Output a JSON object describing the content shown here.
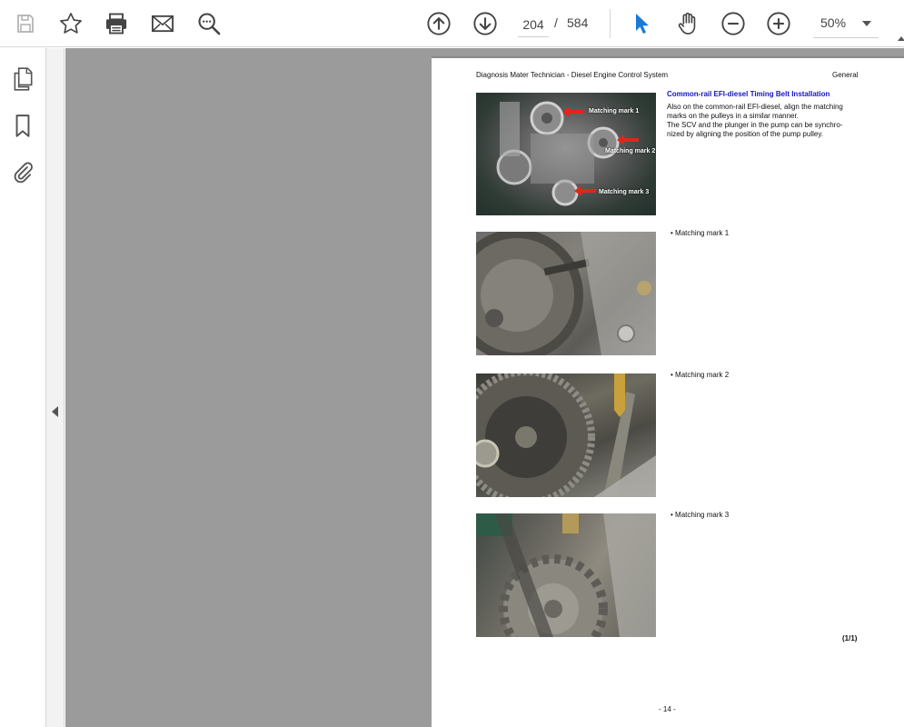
{
  "toolbar": {
    "page_current": "204",
    "page_separator": "/",
    "page_total": "584",
    "zoom": "50%",
    "icons": [
      "save-icon",
      "bookmark-star-icon",
      "print-icon",
      "email-icon",
      "find-icon",
      "previous-page-icon",
      "next-page-icon",
      "select-cursor-icon",
      "hand-tool-icon",
      "zoom-out-icon",
      "zoom-in-icon",
      "zoom-dropdown-icon"
    ],
    "accent_color": "#1a7ad6"
  },
  "left_rail": {
    "icons": [
      "page-thumbnails-icon",
      "bookmarks-icon",
      "attachments-icon"
    ]
  },
  "document": {
    "header_left": "Diagnosis Mater Technician - Diesel Engine Control System",
    "header_right": "General",
    "section_title": "Common-rail EFI-diesel Timing Belt Installation",
    "section_title_color": "#1414c8",
    "body_lines": [
      "Also on the common-rail EFI-diesel, align the matching",
      "marks on the pulleys in a similar manner.",
      "The SCV and the plunger in the pump can be synchro-",
      "nized by aligning the position of the pump pulley."
    ],
    "photo_labels": [
      "Matching mark 1",
      "Matching mark 2",
      "Matching mark 3"
    ],
    "bullets": [
      "Matching mark 1",
      "Matching mark 2",
      "Matching mark 3"
    ],
    "page_count": "(1/1)",
    "footer": "- 14 -"
  }
}
